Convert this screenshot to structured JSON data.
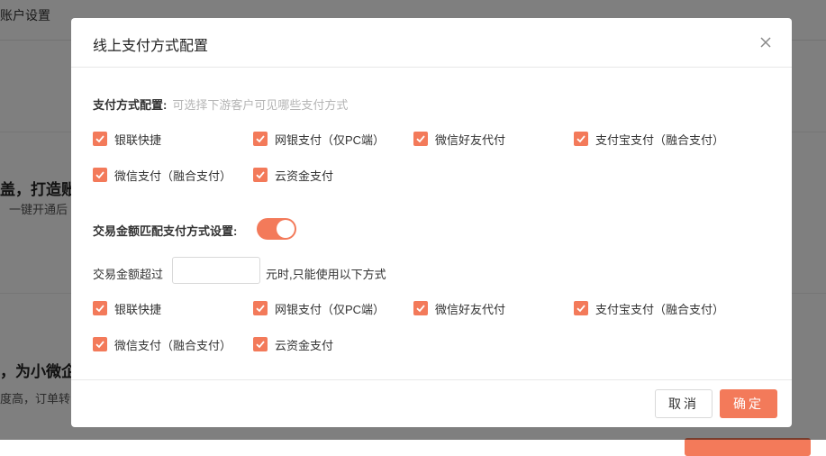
{
  "background": {
    "breadcrumb": "账户设置",
    "heading1": "盖，打造账",
    "sub1": "一键开通后",
    "heading2": "，为小微企",
    "sub2": "度高，订单转"
  },
  "modal": {
    "title": "线上支付方式配置",
    "section1": {
      "label": "支付方式配置:",
      "hint": "可选择下游客户可见哪些支付方式",
      "options": [
        {
          "label": "银联快捷",
          "checked": true
        },
        {
          "label": "网银支付（仅PC端）",
          "checked": true
        },
        {
          "label": "微信好友代付",
          "checked": true
        },
        {
          "label": "支付宝支付（融合支付）",
          "checked": true
        },
        {
          "label": "微信支付（融合支付）",
          "checked": true
        },
        {
          "label": "云资金支付",
          "checked": true
        }
      ]
    },
    "section2": {
      "label": "交易金额匹配支付方式设置:",
      "toggle_on": true,
      "amount_prefix": "交易金额超过",
      "amount_value": "",
      "amount_suffix": "元时,只能使用以下方式",
      "options": [
        {
          "label": "银联快捷",
          "checked": true
        },
        {
          "label": "网银支付（仅PC端）",
          "checked": true
        },
        {
          "label": "微信好友代付",
          "checked": true
        },
        {
          "label": "支付宝支付（融合支付）",
          "checked": true
        },
        {
          "label": "微信支付（融合支付）",
          "checked": true
        },
        {
          "label": "云资金支付",
          "checked": true
        }
      ]
    },
    "footer": {
      "cancel_label": "取消",
      "ok_label": "确定"
    }
  },
  "colors": {
    "accent": "#f37a5a",
    "overlay": "rgba(0,0,0,0.5)"
  }
}
